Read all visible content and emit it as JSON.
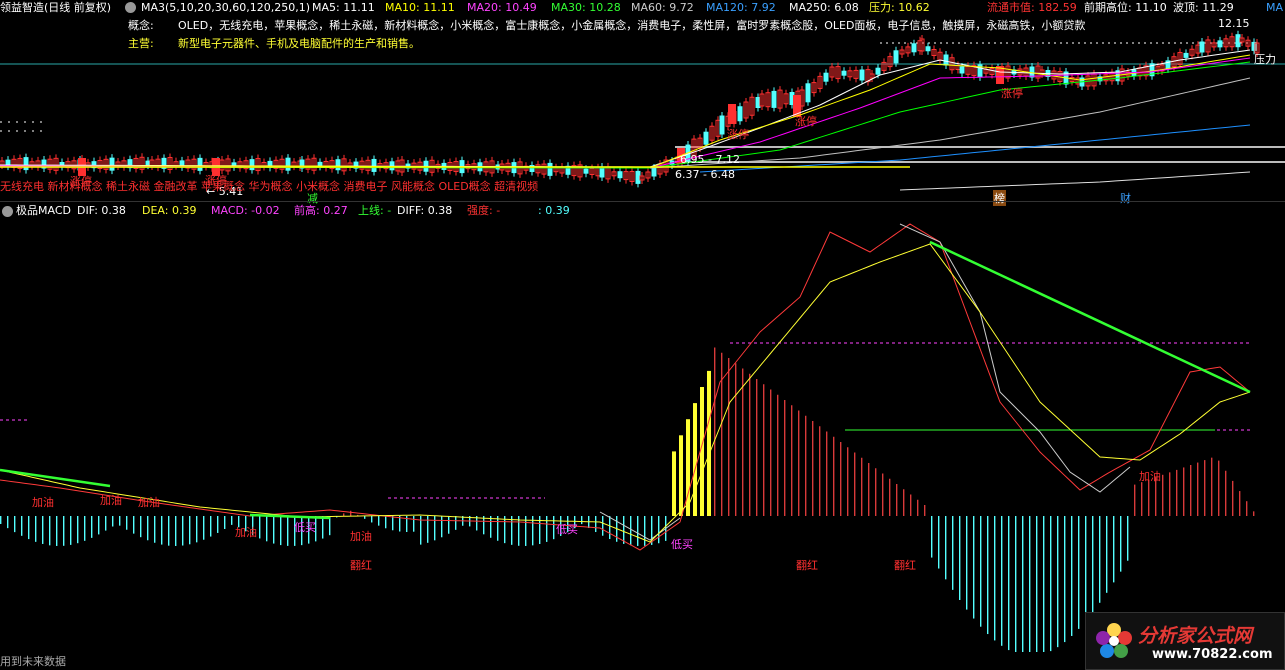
{
  "header": {
    "stock_title": "领益智造(日线 前复权)",
    "ma_set": "MA3(5,10,20,30,60,120,250,1)",
    "ma5": "MA5: 11.11",
    "ma10": "MA10: 11.11",
    "ma20": "MA20: 10.49",
    "ma30": "MA30: 10.28",
    "ma60": "MA60: 9.72",
    "ma120": "MA120: 7.92",
    "ma250": "MA250: 6.08",
    "pressure": "压力: 10.62",
    "float_value": "流通市值: 182.59",
    "prev_high": "前期高位: 11.10",
    "wave_top": "波顶: 11.29",
    "ma_more": "MA"
  },
  "info": {
    "concept_label": "概念:",
    "concept_text": "OLED，无线充电，苹果概念，稀土永磁，新材料概念，小米概念，富士康概念，小金属概念，消费电子，柔性屏，富时罗素概念股，OLED面板，电子信息，触摸屏，永磁高铁，小额贷款",
    "main_label": "主营:",
    "main_text": "新型电子元器件、手机及电脑配件的生产和销售。"
  },
  "price_labels": {
    "high_mark": "12.15",
    "pressure_tag": "压力",
    "limit_up_1": "涨停",
    "limit_up_2": "涨停",
    "limit_up_3": "涨停",
    "limit_up_4": "涨停",
    "limit_up_5": "涨停",
    "range_1": "6.95 - 7.12",
    "range_2": "6.37 - 6.48",
    "low_mark": "← 5.41",
    "tag_jian": "减",
    "tag_bang": "榜",
    "tag_cai": "财",
    "concept_ticker": "无线充电 新材料概念 稀土永磁 金融改革 苹果概念 华为概念 小米概念 消费电子 风能概念 OLED概念 超清视频"
  },
  "macd_header": {
    "name": "极品MACD",
    "dif": "DIF: 0.38",
    "dea": "DEA: 0.39",
    "macd": "MACD: -0.02",
    "prev_high": "前高: 0.27",
    "up_line": "上线: -",
    "diff": "DIFF: 0.38",
    "strength": "强度: -",
    "strength_val": ": 0.39"
  },
  "signals": {
    "jiayou": "加油",
    "dimai": "低买",
    "fanhong": "翻红"
  },
  "footer": {
    "text": "用到未来数据"
  },
  "watermark": {
    "title": "分析家公式网",
    "url": "www.70822.com"
  },
  "colors": {
    "up": "#ff3030",
    "down": "#54ffff",
    "ma5": "#ffffff",
    "ma10": "#ffff00",
    "ma20": "#ff00ff",
    "ma30": "#00ff00",
    "ma60": "#c0c0c0",
    "ma120": "#1e90ff",
    "yellow_bar": "#ffff33",
    "green_trend": "#33ff33"
  }
}
